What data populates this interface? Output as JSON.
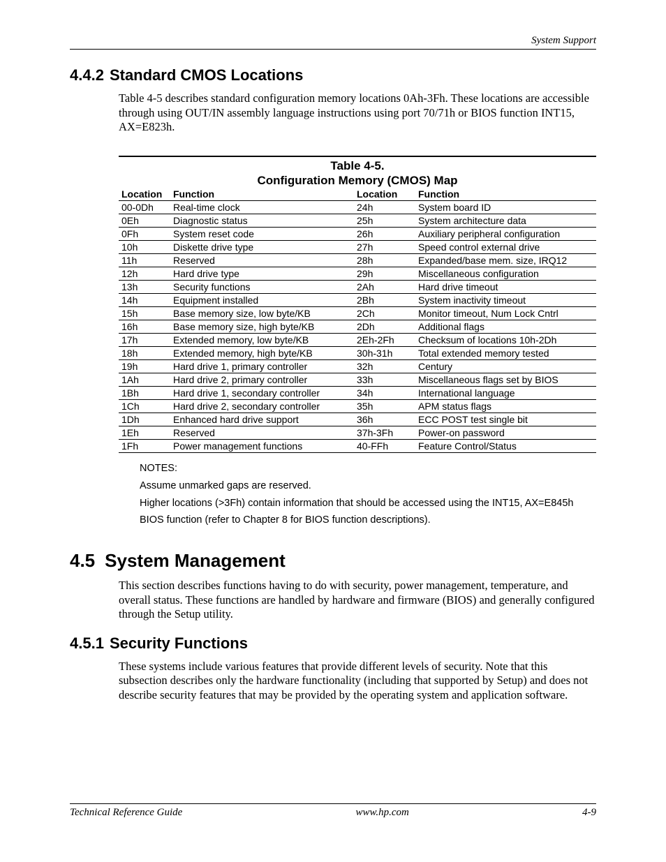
{
  "header": {
    "running_title": "System Support"
  },
  "section_442": {
    "number": "4.4.2",
    "title": "Standard CMOS Locations",
    "para": "Table 4-5 describes standard configuration memory locations 0Ah-3Fh. These locations are accessible through using OUT/IN assembly language instructions using port 70/71h or BIOS function INT15, AX=E823h."
  },
  "table": {
    "caption_line1": "Table 4-5.",
    "caption_line2": "Configuration Memory (CMOS) Map",
    "headers": {
      "loc": "Location",
      "func": "Function",
      "loc2": "Location",
      "func2": "Function"
    },
    "rows": [
      {
        "l1": "00-0Dh",
        "f1": "Real-time clock",
        "l2": "24h",
        "f2": "System board ID"
      },
      {
        "l1": "0Eh",
        "f1": "Diagnostic status",
        "l2": "25h",
        "f2": "System architecture data"
      },
      {
        "l1": "0Fh",
        "f1": "System reset code",
        "l2": "26h",
        "f2": "Auxiliary peripheral configuration"
      },
      {
        "l1": "10h",
        "f1": "Diskette drive type",
        "l2": "27h",
        "f2": "Speed control external drive"
      },
      {
        "l1": "11h",
        "f1": "Reserved",
        "l2": "28h",
        "f2": "Expanded/base mem. size, IRQ12"
      },
      {
        "l1": "12h",
        "f1": "Hard drive type",
        "l2": "29h",
        "f2": "Miscellaneous configuration"
      },
      {
        "l1": "13h",
        "f1": "Security functions",
        "l2": "2Ah",
        "f2": "Hard drive timeout"
      },
      {
        "l1": "14h",
        "f1": "Equipment installed",
        "l2": "2Bh",
        "f2": "System inactivity timeout"
      },
      {
        "l1": "15h",
        "f1": "Base memory size, low byte/KB",
        "l2": "2Ch",
        "f2": "Monitor timeout, Num Lock Cntrl"
      },
      {
        "l1": "16h",
        "f1": "Base memory size, high byte/KB",
        "l2": "2Dh",
        "f2": "Additional flags"
      },
      {
        "l1": "17h",
        "f1": "Extended memory, low byte/KB",
        "l2": "2Eh-2Fh",
        "f2": "Checksum of locations 10h-2Dh"
      },
      {
        "l1": "18h",
        "f1": "Extended memory, high byte/KB",
        "l2": "30h-31h",
        "f2": "Total extended memory tested"
      },
      {
        "l1": "19h",
        "f1": "Hard drive 1, primary controller",
        "l2": "32h",
        "f2": "Century"
      },
      {
        "l1": "1Ah",
        "f1": "Hard drive 2, primary controller",
        "l2": "33h",
        "f2": "Miscellaneous flags set by BIOS"
      },
      {
        "l1": "1Bh",
        "f1": "Hard drive 1, secondary controller",
        "l2": "34h",
        "f2": "International language"
      },
      {
        "l1": "1Ch",
        "f1": "Hard drive 2, secondary controller",
        "l2": "35h",
        "f2": "APM status flags"
      },
      {
        "l1": "1Dh",
        "f1": "Enhanced hard drive support",
        "l2": "36h",
        "f2": "ECC POST test single bit"
      },
      {
        "l1": "1Eh",
        "f1": "Reserved",
        "l2": "37h-3Fh",
        "f2": "Power-on password"
      },
      {
        "l1": "1Fh",
        "f1": "Power management functions",
        "l2": "40-FFh",
        "f2": "Feature Control/Status"
      }
    ]
  },
  "notes": {
    "title": "NOTES:",
    "line1": "Assume unmarked gaps are reserved.",
    "line2": "Higher locations (>3Fh) contain information that should be accessed using the INT15, AX=E845h",
    "line3": "BIOS function (refer to Chapter 8 for BIOS function descriptions)."
  },
  "section_45": {
    "number": "4.5",
    "title": "System Management",
    "para": "This section describes functions having to do with security, power management, temperature, and overall status. These functions are handled by hardware and firmware (BIOS) and generally configured through the Setup utility."
  },
  "section_451": {
    "number": "4.5.1",
    "title": "Security Functions",
    "para": "These systems include various features that provide different levels of security. Note that this subsection describes only the hardware functionality (including that supported by Setup) and does not describe security features that may be provided by the operating system and application software."
  },
  "footer": {
    "left": "Technical Reference Guide",
    "center": "www.hp.com",
    "right": "4-9"
  }
}
